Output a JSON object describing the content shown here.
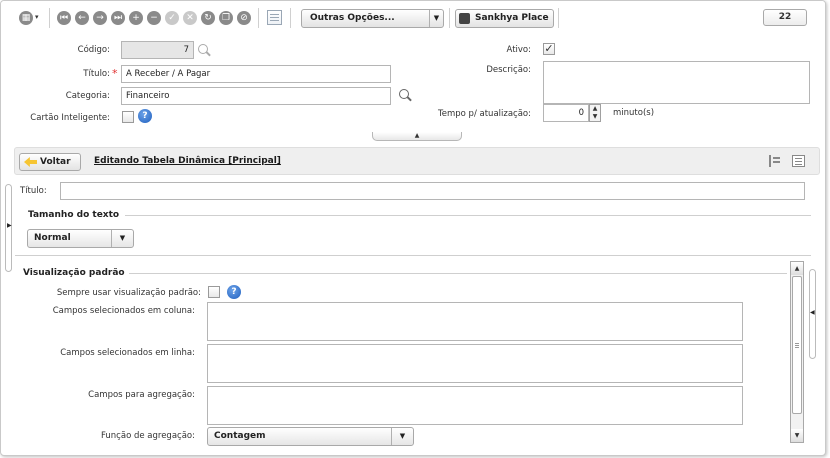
{
  "toolbar": {
    "menu_icon": "grid-menu-icon",
    "nav_icons": [
      "first-record-icon",
      "previous-record-icon",
      "next-record-icon",
      "last-record-icon",
      "add-icon",
      "remove-icon",
      "confirm-icon",
      "cancel-icon",
      "refresh-icon",
      "clone-icon",
      "attach-icon"
    ],
    "grid_icon": "grid-view-icon",
    "more_options_label": "Outras Opções...",
    "sankhya_place_label": "Sankhya Place",
    "counter": "22"
  },
  "form": {
    "codigo_label": "Código:",
    "codigo_value": "7",
    "titulo_label": "Título:",
    "titulo_value": "A Receber / A Pagar",
    "categoria_label": "Categoria:",
    "categoria_value": "Financeiro",
    "cartao_label": "Cartão Inteligente:",
    "cartao_checked": false,
    "ativo_label": "Ativo:",
    "ativo_checked": true,
    "descricao_label": "Descrição:",
    "descricao_value": "",
    "tempo_label": "Tempo p/ atualização:",
    "tempo_value": "0",
    "tempo_unit": "minuto(s)"
  },
  "pivot": {
    "back_label": "Voltar",
    "title": "Editando Tabela Dinâmica [Principal]",
    "titulo_label": "Título:",
    "titulo_value": "",
    "tamanho_section": "Tamanho do texto",
    "tamanho_value": "Normal",
    "visualizacao_section": "Visualização padrão",
    "sempre_label": "Sempre usar visualização padrão:",
    "sempre_checked": false,
    "colunas_label": "Campos selecionados em coluna:",
    "linhas_label": "Campos selecionados em linha:",
    "agregacao_campos_label": "Campos para agregação:",
    "funcao_label": "Função de agregação:",
    "funcao_value": "Contagem"
  },
  "colors": {
    "required": "#e03030",
    "help": "#1f5fbf",
    "back_arrow": "#f6c532"
  }
}
